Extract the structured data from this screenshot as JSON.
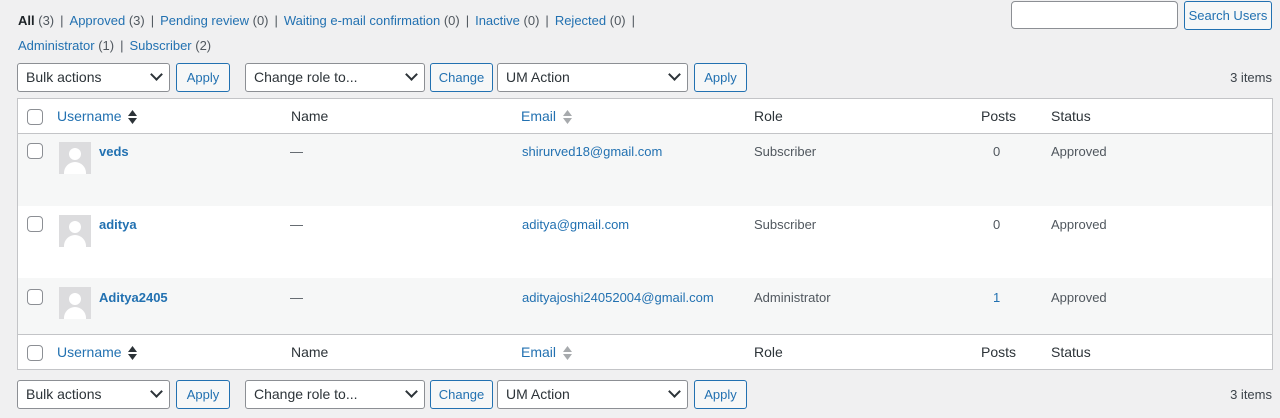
{
  "filters_row1": [
    {
      "label": "All",
      "count": "(3)",
      "current": true
    },
    {
      "label": "Approved",
      "count": "(3)"
    },
    {
      "label": "Pending review",
      "count": "(0)"
    },
    {
      "label": "Waiting e-mail confirmation",
      "count": "(0)"
    },
    {
      "label": "Inactive",
      "count": "(0)"
    },
    {
      "label": "Rejected",
      "count": "(0)"
    }
  ],
  "filters_row2": [
    {
      "label": "Administrator",
      "count": "(1)"
    },
    {
      "label": "Subscriber",
      "count": "(2)"
    }
  ],
  "search": {
    "value": "",
    "button": "Search Users"
  },
  "top_actions": {
    "bulk": "Bulk actions",
    "apply": "Apply",
    "role": "Change role to...",
    "change": "Change",
    "um": "UM Action",
    "apply2": "Apply",
    "items": "3 items"
  },
  "bottom_actions": {
    "bulk": "Bulk actions",
    "apply": "Apply",
    "role": "Change role to...",
    "change": "Change",
    "um": "UM Action",
    "apply2": "Apply",
    "items": "3 items"
  },
  "columns": {
    "username": "Username",
    "name": "Name",
    "email": "Email",
    "role": "Role",
    "posts": "Posts",
    "status": "Status"
  },
  "users": [
    {
      "username": "veds",
      "name": "—",
      "email": "shirurved18@gmail.com",
      "role": "Subscriber",
      "posts": "0",
      "status": "Approved"
    },
    {
      "username": "aditya",
      "name": "—",
      "email": "aditya@gmail.com",
      "role": "Subscriber",
      "posts": "0",
      "status": "Approved"
    },
    {
      "username": "Aditya2405",
      "name": "—",
      "email": "adityajoshi24052004@gmail.com",
      "role": "Administrator",
      "posts": "1",
      "status": "Approved"
    }
  ],
  "colors": {
    "link": "#2271b1",
    "background": "#f0f0f1",
    "row_alt": "#f6f7f7"
  },
  "icons": {
    "sort": "sort-arrows-icon",
    "avatar": "default-avatar-icon",
    "dropdown": "chevron-down-icon"
  }
}
